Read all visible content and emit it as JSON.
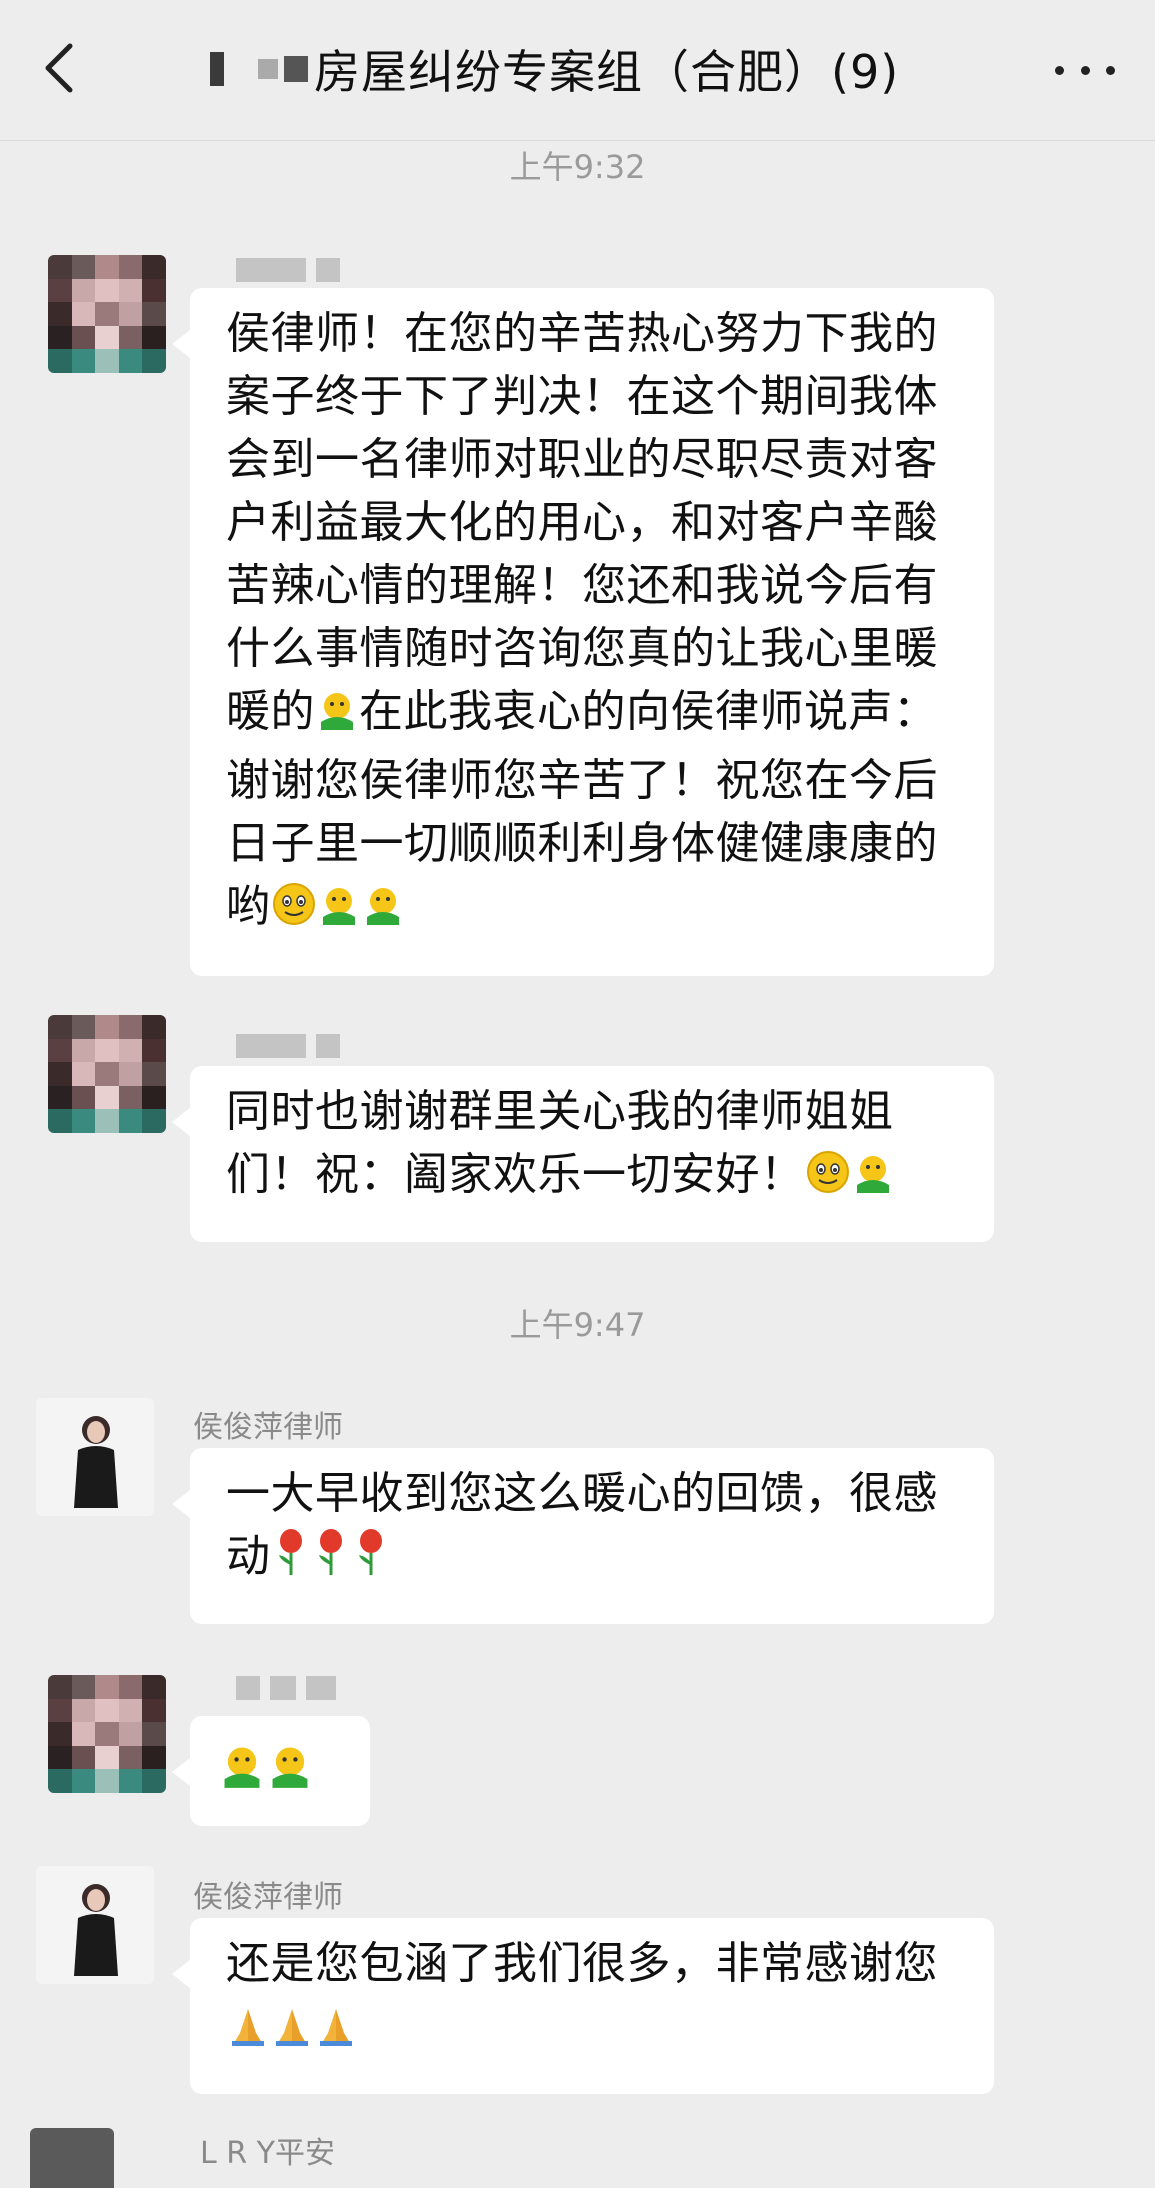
{
  "header": {
    "title": "房屋纠纷专案组（合肥）(9)",
    "back_icon": "chevron-left-icon",
    "more_icon": "more-dots-icon"
  },
  "timestamps": [
    "上午9:32",
    "上午9:47"
  ],
  "messages": [
    {
      "sender": "",
      "text": "侯律师！在您的辛苦热心努力下我的案子终于下了判决！在这个期间我体会到一名律师对职业的尽职尽责对客户利益最大化的用心，和对客户辛酸苦辣心情的理解！您还和我说今后有什么事情随时咨询您真的让我心里暖暖的",
      "text2": "在此我衷心的向侯律师说声：谢谢您侯律师您辛苦了！祝您在今后日子里一切顺顺利利身体健健康康的哟",
      "emojis": [
        "hug-emoji",
        "smile-emoji",
        "hug-emoji",
        "hug-emoji"
      ]
    },
    {
      "sender": "",
      "text": "同时也谢谢群里关心我的律师姐姐们！祝：阖家欢乐一切安好！",
      "emojis": [
        "smile-emoji",
        "hug-emoji"
      ]
    },
    {
      "sender": "侯俊萍律师",
      "text": "一大早收到您这么暖心的回馈，很感动",
      "emojis": [
        "rose-emoji",
        "rose-emoji",
        "rose-emoji"
      ]
    },
    {
      "sender": "",
      "text": "",
      "emojis": [
        "hug-emoji",
        "hug-emoji"
      ]
    },
    {
      "sender": "侯俊萍律师",
      "text": "还是您包涵了我们很多，非常感谢您",
      "emojis": [
        "pray-emoji",
        "pray-emoji",
        "pray-emoji"
      ]
    }
  ],
  "bottom_partial_sender": "L R Y平安",
  "colors": {
    "background": "#ededed",
    "bubble": "#ffffff",
    "timestamp": "#9a9a9a"
  }
}
